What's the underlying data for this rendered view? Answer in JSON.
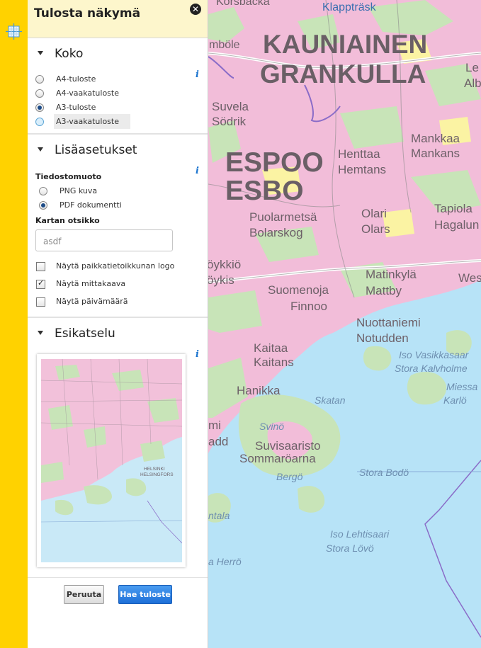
{
  "panel": {
    "title": "Tulosta näkymä",
    "close_icon": "close-icon",
    "size_section": {
      "title": "Koko",
      "options": [
        "A4-tuloste",
        "A4-vaakatuloste",
        "A3-tuloste",
        "A3-vaakatuloste"
      ],
      "selected": "A3-tuloste"
    },
    "settings_section": {
      "title": "Lisäasetukset",
      "file_format_label": "Tiedostomuoto",
      "formats": [
        "PNG kuva",
        "PDF dokumentti"
      ],
      "selected_format": "PDF dokumentti",
      "map_title_label": "Kartan otsikko",
      "map_title_value": "asdf",
      "checkboxes": [
        {
          "label": "Näytä paikkatietoikkunan logo",
          "checked": false
        },
        {
          "label": "Näytä mittakaava",
          "checked": true
        },
        {
          "label": "Näytä päivämäärä",
          "checked": false
        }
      ]
    },
    "preview_section": {
      "title": "Esikatselu",
      "preview_labels": [
        "HELSINKI",
        "HELSINGFORS"
      ]
    },
    "buttons": {
      "cancel": "Peruuta",
      "print": "Hae tuloste"
    }
  },
  "map_labels": {
    "klapptrask": "Klappträsk",
    "korsbacka": "Korsbacka",
    "mbole": "mböle",
    "kauniainen": "KAUNIAINEN",
    "grankulla": "GRANKULLA",
    "le": "Le",
    "alb": "Alb",
    "suvela": "Suvela",
    "sodrik": "Södrik",
    "espoo": "ESPOO",
    "esbo": "ESBO",
    "henttaa": "Henttaa",
    "hemtans": "Hemtans",
    "mankkaa": "Mankkaa",
    "mankans": "Mankans",
    "tapiola": "Tapiola",
    "hagalund": "Hagalun",
    "puolarmetsa": "Puolarmetsä",
    "bolarskog": "Bolarskog",
    "olari": "Olari",
    "olars": "Olars",
    "loykkio": "öykkiö",
    "loykis": "öykis",
    "matinkyla": "Matinkylä",
    "mattby": "Mattby",
    "wes": "Wes",
    "suomenoja": "Suomenoja",
    "finnoo": "Finnoo",
    "nuottaniemi": "Nuottaniemi",
    "notudden": "Notudden",
    "iso_vasikkasaari": "Iso Vasikkasaar",
    "stora_kalvholmen": "Stora Kalvholme",
    "kaitaa": "Kaitaa",
    "kaitans": "Kaitans",
    "miessaari": "Miessa",
    "karlo": "Karlö",
    "hanikka": "Hanikka",
    "skatan": "Skatan",
    "svino": "Svinö",
    "mi": "mi",
    "add": "add",
    "suvisaaristo": "Suvisaaristo",
    "sommaroarna": "Sommaröarna",
    "stora_bodo": "Stora Bodö",
    "bergo": "Bergö",
    "ntala": "ntala",
    "iso_lehtisaari": "Iso Lehtisaari",
    "stora_lovo": "Stora Lövö",
    "stora_herro": "a Herrö"
  }
}
